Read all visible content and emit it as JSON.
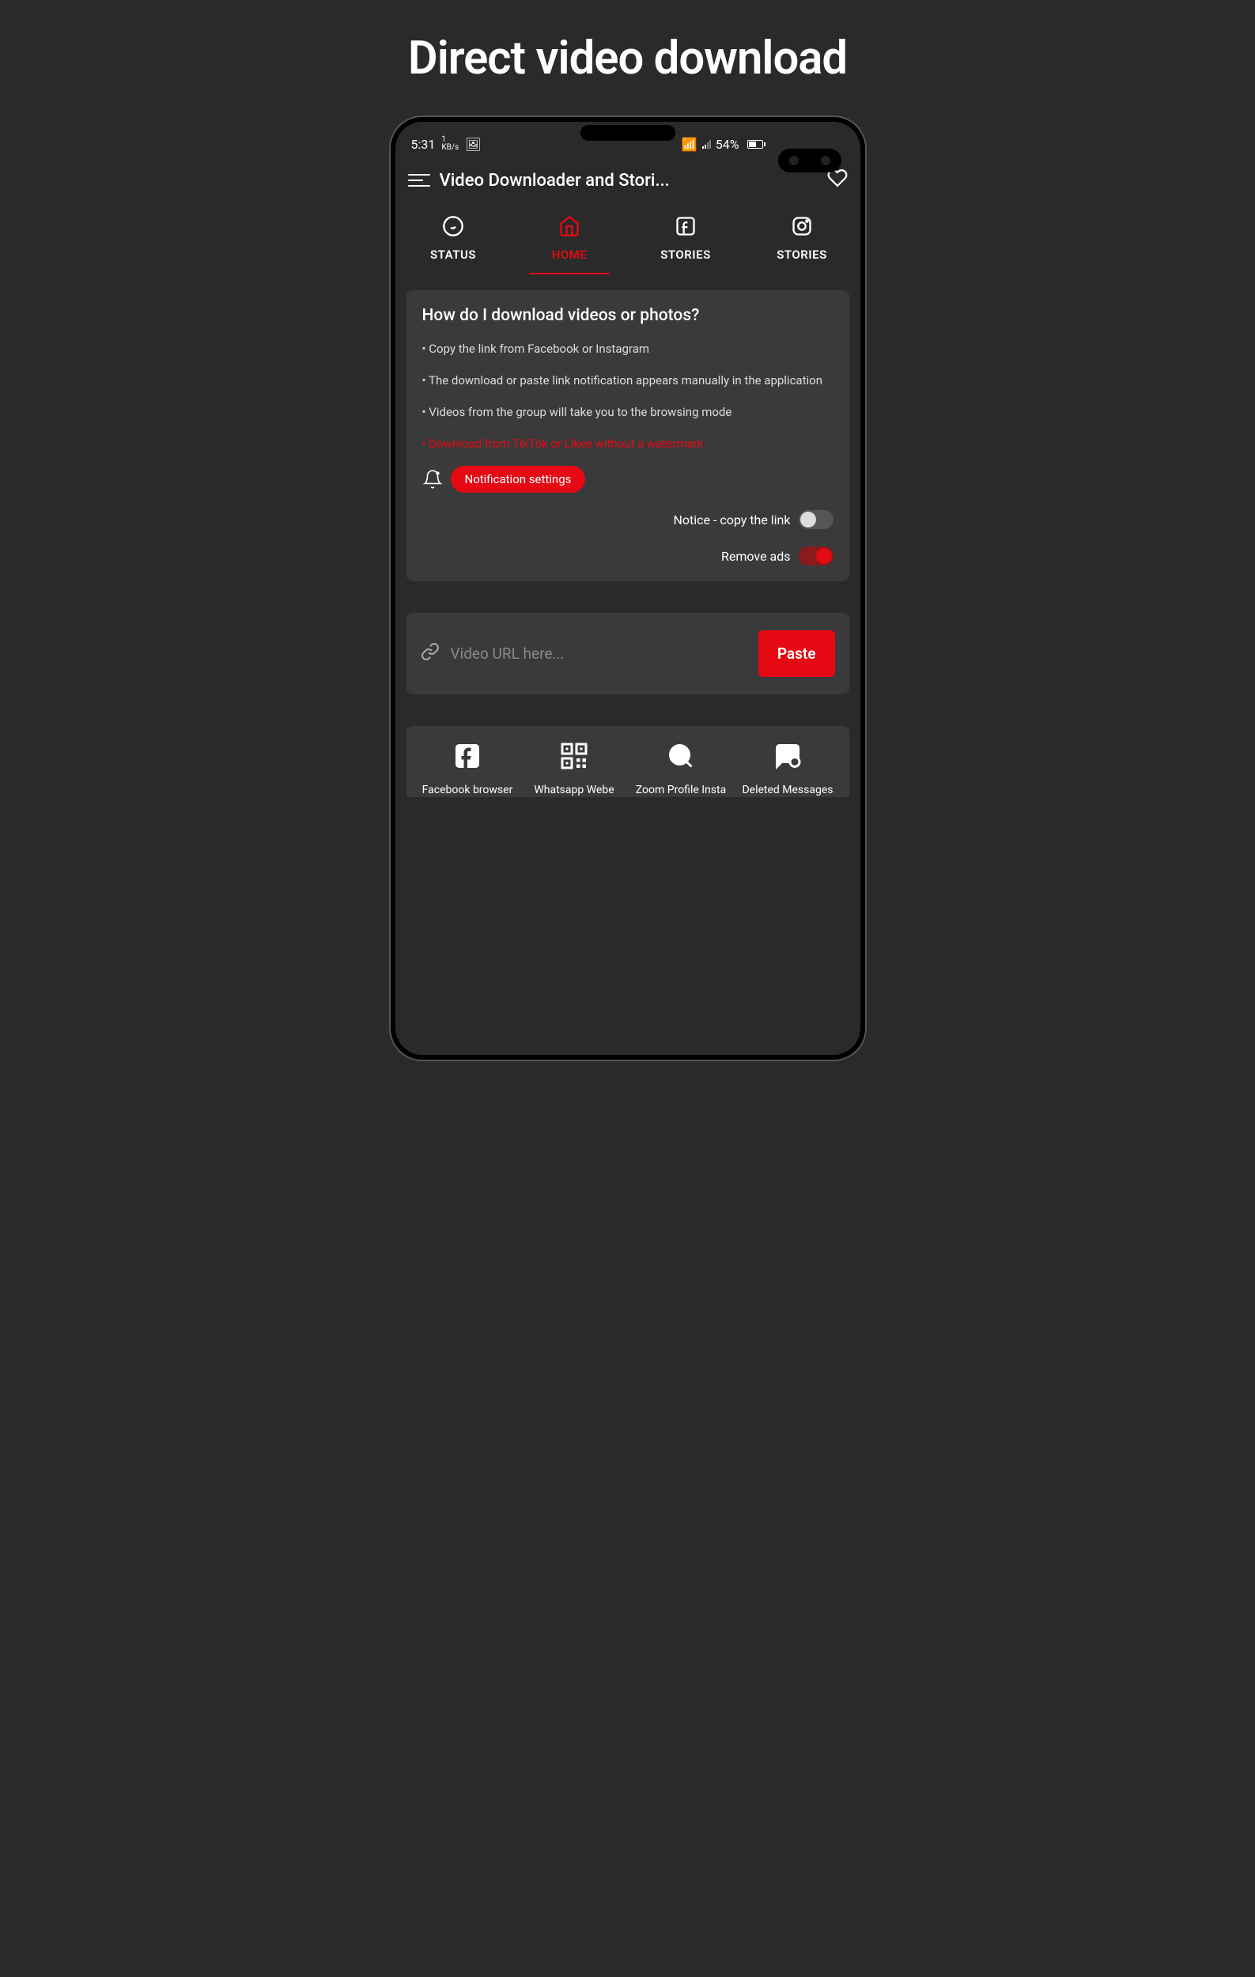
{
  "pageTitle": "Direct video download",
  "statusBar": {
    "time": "5:31",
    "kbs": "1",
    "kbsUnit": "KB/s",
    "battery": "54%"
  },
  "header": {
    "title": "Video Downloader and Stori..."
  },
  "tabs": [
    {
      "label": "STATUS",
      "icon": "whatsapp"
    },
    {
      "label": "HOME",
      "icon": "home",
      "active": true
    },
    {
      "label": "STORIES",
      "icon": "facebook"
    },
    {
      "label": "STORIES",
      "icon": "instagram"
    }
  ],
  "howto": {
    "title": "How do I download videos or photos?",
    "bullets": [
      "• Copy the link from Facebook or Instagram",
      "• The download or paste link notification appears manually in the application",
      "• Videos from the group will take you to the browsing mode"
    ],
    "redBullet": "• Download from TikTok or Likee without a watermark",
    "notifBtn": "Notification settings",
    "toggle1": "Notice - copy the link",
    "toggle2": "Remove ads"
  },
  "url": {
    "placeholder": "Video URL here...",
    "pasteBtn": "Paste"
  },
  "tools": [
    {
      "label": "Facebook browser"
    },
    {
      "label": "Whatsapp Webe"
    },
    {
      "label": "Zoom Profile Insta"
    },
    {
      "label": "Deleted Messages"
    }
  ]
}
